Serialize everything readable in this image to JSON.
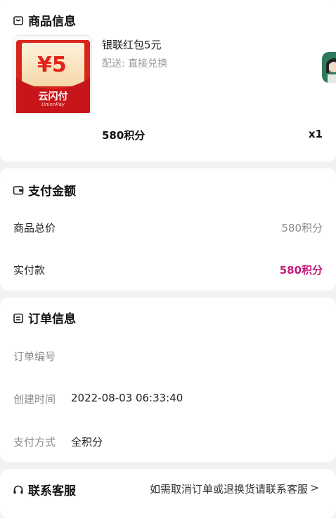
{
  "product": {
    "section_title": "商品信息",
    "name": "银联红包5元",
    "shipping": "配送: 直接兑换",
    "price": "580积分",
    "quantity": "x1",
    "thumb_amount": "¥5",
    "thumb_brand": "云闪付",
    "thumb_sub": "UnionPay"
  },
  "payment": {
    "section_title": "支付金额",
    "total_label": "商品总价",
    "total_value": "580积分",
    "paid_label": "实付款",
    "paid_value": "580积分"
  },
  "order": {
    "section_title": "订单信息",
    "number_label": "订单编号",
    "number_value": "",
    "created_label": "创建时间",
    "created_value": "2022-08-03 06:33:40",
    "method_label": "支付方式",
    "method_value": "全积分"
  },
  "service": {
    "section_title": "联系客服",
    "link_text": "如需取消订单或退换货请联系客服",
    "chevron": ">"
  },
  "colors": {
    "accent": "#c2197a",
    "background": "#f2f2f4",
    "card": "#ffffff"
  }
}
